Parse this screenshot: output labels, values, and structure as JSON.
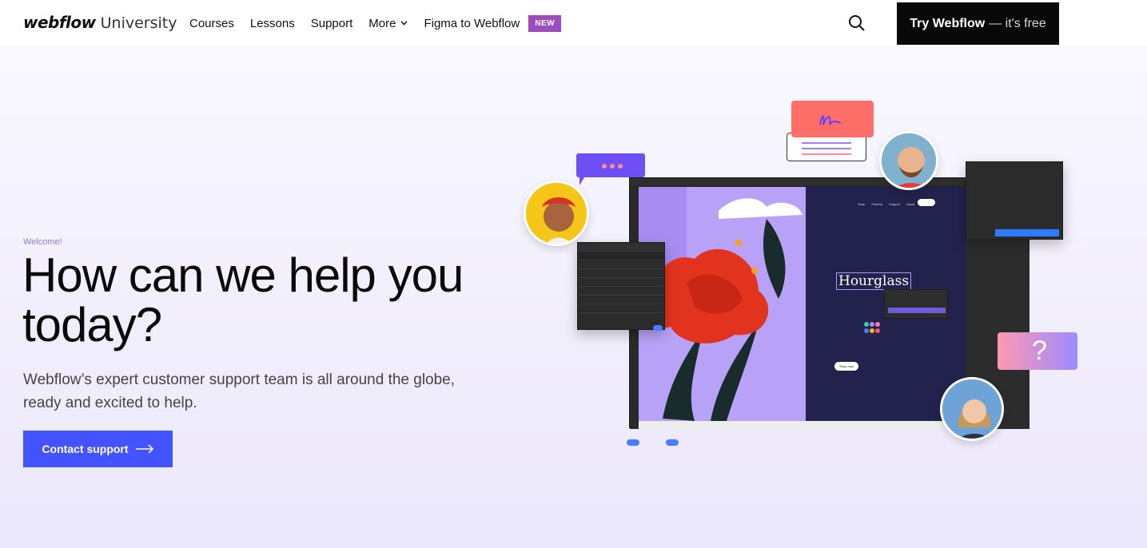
{
  "brand": {
    "main": "webflow",
    "sub": "University"
  },
  "nav": {
    "links": [
      "Courses",
      "Lessons",
      "Support",
      "More",
      "Figma to Webflow"
    ],
    "new_badge": "NEW",
    "cta_strong": "Try Webflow",
    "cta_light": "— it's free"
  },
  "hero": {
    "eyebrow": "Welcome!",
    "headline": "How can we help you today?",
    "subtext": "Webflow’s expert customer support team is all around the globe, ready and excited to help.",
    "button": "Contact support"
  },
  "illustration": {
    "product_title": "Hourglass",
    "shop_button": "Shop now",
    "mini_nav": [
      "Shop",
      "Posters",
      "Support",
      "About"
    ]
  },
  "colors": {
    "accent": "#4353ff",
    "badge": "#9b4dbd",
    "cta_bg": "#080808"
  },
  "icons": {
    "search": "search-icon",
    "chevron": "chevron-down-icon",
    "arrow": "arrow-right-icon"
  }
}
